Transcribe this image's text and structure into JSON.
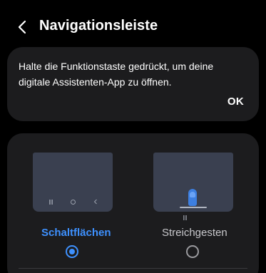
{
  "header": {
    "title": "Navigationsleiste"
  },
  "info_card": {
    "message": "Halte die Funktionstaste gedrückt, um deine digitale Assistenten-App zu öffnen.",
    "ok_label": "OK"
  },
  "options": {
    "buttons_label": "Schaltflächen",
    "gestures_label": "Streichgesten",
    "selected": "Schaltflächen"
  },
  "colors": {
    "accent": "#3e91ff",
    "card_bg": "#1c1c1e",
    "preview_bg": "#3a4050"
  },
  "icons": {
    "back": "chevron-left-icon",
    "recents": "recents-icon",
    "home": "home-icon",
    "nav_back": "nav-back-icon",
    "finger": "finger-swipe-icon"
  }
}
